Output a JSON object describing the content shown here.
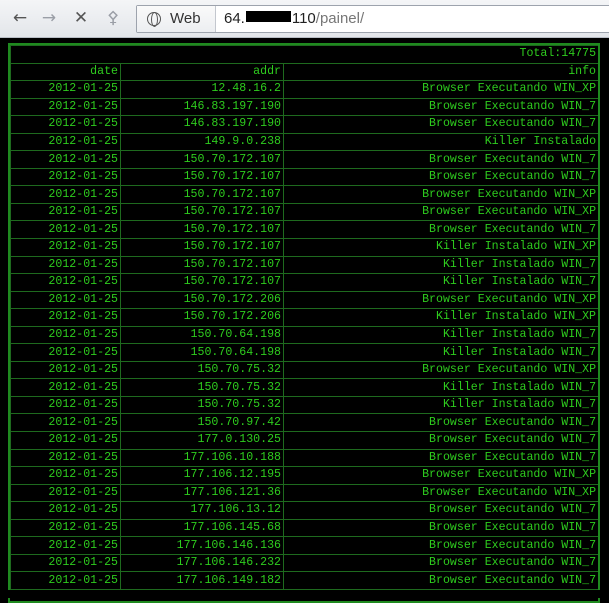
{
  "browser": {
    "nav": {
      "back_icon": "arrow-left",
      "forward_icon": "arrow-right",
      "stop_icon": "close-x",
      "key_icon": "key"
    },
    "site_chip_label": "Web",
    "url_prefix": "64.",
    "url_suffix": "110",
    "url_path": "/painel/"
  },
  "table": {
    "total_label": "Total:14775",
    "headers": [
      "date",
      "addr",
      "info"
    ],
    "rows": [
      [
        "2012-01-25",
        "12.48.16.2",
        "Browser Executando WIN_XP"
      ],
      [
        "2012-01-25",
        "146.83.197.190",
        "Browser Executando WIN_7"
      ],
      [
        "2012-01-25",
        "146.83.197.190",
        "Browser Executando WIN_7"
      ],
      [
        "2012-01-25",
        "149.9.0.238",
        "Killer Instalado"
      ],
      [
        "2012-01-25",
        "150.70.172.107",
        "Browser Executando WIN_7"
      ],
      [
        "2012-01-25",
        "150.70.172.107",
        "Browser Executando WIN_7"
      ],
      [
        "2012-01-25",
        "150.70.172.107",
        "Browser Executando WIN_XP"
      ],
      [
        "2012-01-25",
        "150.70.172.107",
        "Browser Executando WIN_XP"
      ],
      [
        "2012-01-25",
        "150.70.172.107",
        "Browser Executando WIN_7"
      ],
      [
        "2012-01-25",
        "150.70.172.107",
        "Killer Instalado WIN_XP"
      ],
      [
        "2012-01-25",
        "150.70.172.107",
        "Killer Instalado WIN_7"
      ],
      [
        "2012-01-25",
        "150.70.172.107",
        "Killer Instalado WIN_7"
      ],
      [
        "2012-01-25",
        "150.70.172.206",
        "Browser Executando WIN_XP"
      ],
      [
        "2012-01-25",
        "150.70.172.206",
        "Killer Instalado WIN_XP"
      ],
      [
        "2012-01-25",
        "150.70.64.198",
        "Killer Instalado WIN_7"
      ],
      [
        "2012-01-25",
        "150.70.64.198",
        "Killer Instalado WIN_7"
      ],
      [
        "2012-01-25",
        "150.70.75.32",
        "Browser Executando WIN_XP"
      ],
      [
        "2012-01-25",
        "150.70.75.32",
        "Killer Instalado WIN_7"
      ],
      [
        "2012-01-25",
        "150.70.75.32",
        "Killer Instalado WIN_7"
      ],
      [
        "2012-01-25",
        "150.70.97.42",
        "Browser Executando WIN_7"
      ],
      [
        "2012-01-25",
        "177.0.130.25",
        "Browser Executando WIN_7"
      ],
      [
        "2012-01-25",
        "177.106.10.188",
        "Browser Executando WIN_7"
      ],
      [
        "2012-01-25",
        "177.106.12.195",
        "Browser Executando WIN_XP"
      ],
      [
        "2012-01-25",
        "177.106.121.36",
        "Browser Executando WIN_XP"
      ],
      [
        "2012-01-25",
        "177.106.13.12",
        "Browser Executando WIN_7"
      ],
      [
        "2012-01-25",
        "177.106.145.68",
        "Browser Executando WIN_7"
      ],
      [
        "2012-01-25",
        "177.106.146.136",
        "Browser Executando WIN_7"
      ],
      [
        "2012-01-25",
        "177.106.146.232",
        "Browser Executando WIN_7"
      ],
      [
        "2012-01-25",
        "177.106.149.182",
        "Browser Executando WIN_7"
      ]
    ]
  },
  "colors": {
    "text_green": "#2ecc1e",
    "border_green": "#1e6a1e",
    "background": "#000000"
  }
}
